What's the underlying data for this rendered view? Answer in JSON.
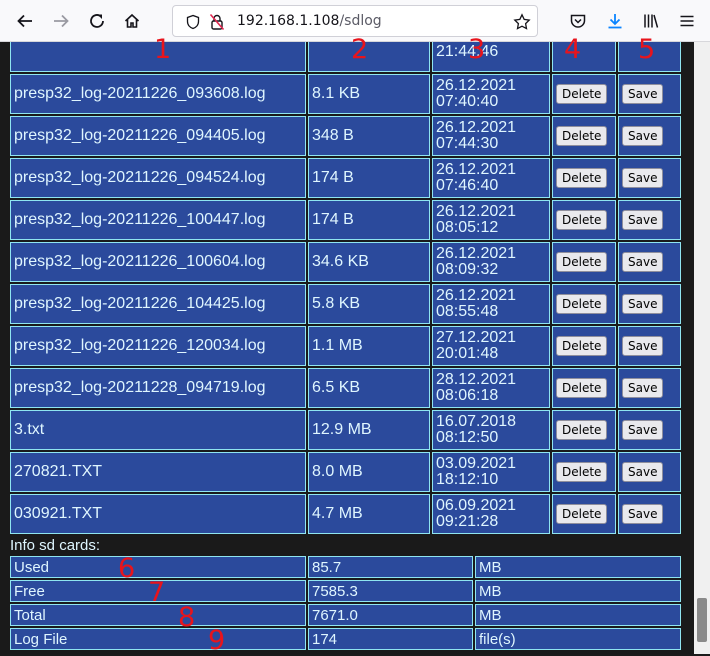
{
  "browser": {
    "url_host": "192.168.1.108",
    "url_path": "/sdlog"
  },
  "files": [
    {
      "name": "",
      "size": "",
      "date": "",
      "time": "21:44:46",
      "delete": "",
      "save": ""
    },
    {
      "name": "presp32_log-20211226_093608.log",
      "size": "8.1 KB",
      "date": "26.12.2021",
      "time": "07:40:40",
      "delete": "Delete",
      "save": "Save"
    },
    {
      "name": "presp32_log-20211226_094405.log",
      "size": "348 B",
      "date": "26.12.2021",
      "time": "07:44:30",
      "delete": "Delete",
      "save": "Save"
    },
    {
      "name": "presp32_log-20211226_094524.log",
      "size": "174 B",
      "date": "26.12.2021",
      "time": "07:46:40",
      "delete": "Delete",
      "save": "Save"
    },
    {
      "name": "presp32_log-20211226_100447.log",
      "size": "174 B",
      "date": "26.12.2021",
      "time": "08:05:12",
      "delete": "Delete",
      "save": "Save"
    },
    {
      "name": "presp32_log-20211226_100604.log",
      "size": "34.6 KB",
      "date": "26.12.2021",
      "time": "08:09:32",
      "delete": "Delete",
      "save": "Save"
    },
    {
      "name": "presp32_log-20211226_104425.log",
      "size": "5.8 KB",
      "date": "26.12.2021",
      "time": "08:55:48",
      "delete": "Delete",
      "save": "Save"
    },
    {
      "name": "presp32_log-20211226_120034.log",
      "size": "1.1 MB",
      "date": "27.12.2021",
      "time": "20:01:48",
      "delete": "Delete",
      "save": "Save"
    },
    {
      "name": "presp32_log-20211228_094719.log",
      "size": "6.5 KB",
      "date": "28.12.2021",
      "time": "08:06:18",
      "delete": "Delete",
      "save": "Save"
    },
    {
      "name": "3.txt",
      "size": "12.9 MB",
      "date": "16.07.2018",
      "time": "08:12:50",
      "delete": "Delete",
      "save": "Save"
    },
    {
      "name": "270821.TXT",
      "size": "8.0 MB",
      "date": "03.09.2021",
      "time": "18:12:10",
      "delete": "Delete",
      "save": "Save"
    },
    {
      "name": "030921.TXT",
      "size": "4.7 MB",
      "date": "06.09.2021",
      "time": "09:21:28",
      "delete": "Delete",
      "save": "Save"
    }
  ],
  "info": {
    "title": "Info sd cards:",
    "rows": [
      {
        "label": "Used",
        "value": "85.7",
        "unit": "MB"
      },
      {
        "label": "Free",
        "value": "7585.3",
        "unit": "MB"
      },
      {
        "label": "Total",
        "value": "7671.0",
        "unit": "MB"
      },
      {
        "label": "Log File",
        "value": "174",
        "unit": "file(s)"
      }
    ]
  },
  "annotations": [
    "1",
    "2",
    "3",
    "4",
    "5",
    "6",
    "7",
    "8",
    "9"
  ],
  "colors": {
    "cell_bg": "#2b4a9c",
    "cell_border": "#8fe5f0",
    "cell_text": "#dff6ff",
    "annotation": "#e8141c"
  },
  "icons": [
    "back-arrow-icon",
    "forward-arrow-icon",
    "reload-icon",
    "home-icon",
    "shield-icon",
    "insecure-lock-icon",
    "star-icon",
    "pocket-icon",
    "download-icon",
    "library-icon",
    "menu-icon"
  ]
}
